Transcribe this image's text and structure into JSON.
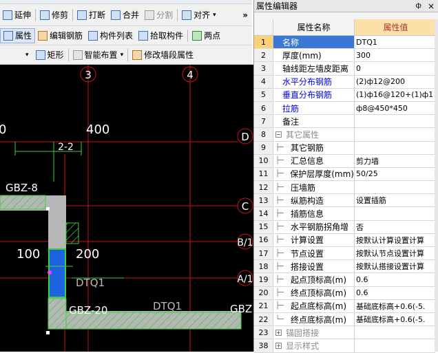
{
  "toolbar": {
    "row1": {
      "extend": "延伸",
      "trim": "修剪",
      "break": "打断",
      "merge": "合并",
      "split": "分割",
      "align": "对齐"
    },
    "row2": {
      "properties": "属性",
      "edit_rebar": "编辑钢筋",
      "component_list": "构件列表",
      "pick_component": "拾取构件",
      "two_points": "两点"
    },
    "row3": {
      "rectangle": "矩形",
      "smart_layout": "智能布置",
      "modify_segment": "修改墙段属性"
    },
    "more": "»"
  },
  "canvas": {
    "axis_labels": {
      "a3": "3",
      "a4": "4",
      "aD": "D",
      "aC": "C",
      "aB": "B/1",
      "aA": "A/1"
    },
    "dims": {
      "d400": "400",
      "d0": "0",
      "d22": "2-2",
      "d100": "100",
      "d200": "200"
    },
    "tags": {
      "gbz8": "GBZ-8",
      "dtq1a": "DTQ1",
      "gbz20": "GBZ-20",
      "dtq1b": "DTQ1",
      "gbz": "GBZ"
    }
  },
  "panel": {
    "title": "属性编辑器",
    "pin": "ф",
    "close": "×",
    "col_name": "属性名称",
    "col_value": "属性值",
    "rows": [
      {
        "num": "1",
        "name": "名称",
        "value": "DTQ1"
      },
      {
        "num": "2",
        "name": "厚度(mm)",
        "value": "300"
      },
      {
        "num": "3",
        "name": "轴线距左墙皮距离",
        "value": "0"
      },
      {
        "num": "4",
        "name": "水平分布钢筋",
        "value": "(2)ф12@200"
      },
      {
        "num": "5",
        "name": "垂直分布钢筋",
        "value": "(1)ф16@120+(1)ф1"
      },
      {
        "num": "6",
        "name": "拉筋",
        "value": "ф8@450*450"
      },
      {
        "num": "7",
        "name": "备注",
        "value": ""
      },
      {
        "num": "8",
        "name": "其它属性",
        "value": ""
      },
      {
        "num": "9",
        "name": "其它钢筋",
        "value": ""
      },
      {
        "num": "10",
        "name": "汇总信息",
        "value": "剪力墙"
      },
      {
        "num": "11",
        "name": "保护层厚度(mm)",
        "value": "50/25"
      },
      {
        "num": "12",
        "name": "压墙筋",
        "value": ""
      },
      {
        "num": "13",
        "name": "纵筋构造",
        "value": "设置插筋"
      },
      {
        "num": "14",
        "name": "插筋信息",
        "value": ""
      },
      {
        "num": "15",
        "name": "水平钢筋拐角增",
        "value": "否"
      },
      {
        "num": "16",
        "name": "计算设置",
        "value": "按默认计算设置计算"
      },
      {
        "num": "17",
        "name": "节点设置",
        "value": "按默认节点设置计算"
      },
      {
        "num": "18",
        "name": "搭接设置",
        "value": "按默认搭接设置计算"
      },
      {
        "num": "19",
        "name": "起点顶标高(m)",
        "value": "0.6"
      },
      {
        "num": "20",
        "name": "终点顶标高(m)",
        "value": "0.6"
      },
      {
        "num": "21",
        "name": "起点底标高(m)",
        "value": "基础底标高+0.6(-5."
      },
      {
        "num": "22",
        "name": "终点底标高(m)",
        "value": "基础底标高+0.6(-5."
      },
      {
        "num": "23",
        "name": "锚固搭接",
        "value": ""
      },
      {
        "num": "38",
        "name": "显示样式",
        "value": ""
      }
    ]
  }
}
